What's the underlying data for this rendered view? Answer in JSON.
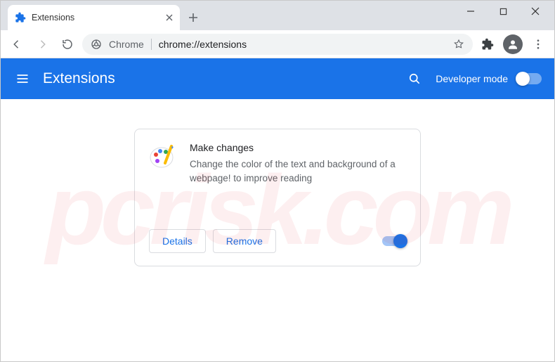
{
  "window": {
    "tab_title": "Extensions"
  },
  "omnibox": {
    "scheme_label": "Chrome",
    "url": "chrome://extensions"
  },
  "header": {
    "title": "Extensions",
    "dev_mode_label": "Developer mode",
    "dev_mode_on": false
  },
  "extension": {
    "name": "Make changes",
    "description": "Change the color of the text and background of a webpage! to improve reading",
    "details_label": "Details",
    "remove_label": "Remove",
    "enabled": true
  }
}
